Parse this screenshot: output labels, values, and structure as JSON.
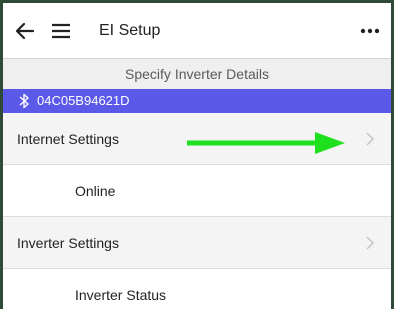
{
  "header": {
    "title": "EI Setup",
    "back_icon": "arrow-left-icon",
    "menu_icon": "hamburger-menu-icon",
    "more_icon": "more-horizontal-icon"
  },
  "subheader": {
    "text": "Specify Inverter Details"
  },
  "device": {
    "icon": "bluetooth-icon",
    "id": "04C05B94621D",
    "bar_color": "#5b59e8"
  },
  "rows": [
    {
      "label": "Internet Settings",
      "chevron": true
    },
    {
      "label": "Online",
      "chevron": false
    },
    {
      "label": "Inverter Settings",
      "chevron": true
    },
    {
      "label": "Inverter Status",
      "chevron": false
    }
  ],
  "annotation": {
    "arrow_color": "#1ee01e",
    "arrow_icon": "green-arrow-right-icon"
  }
}
